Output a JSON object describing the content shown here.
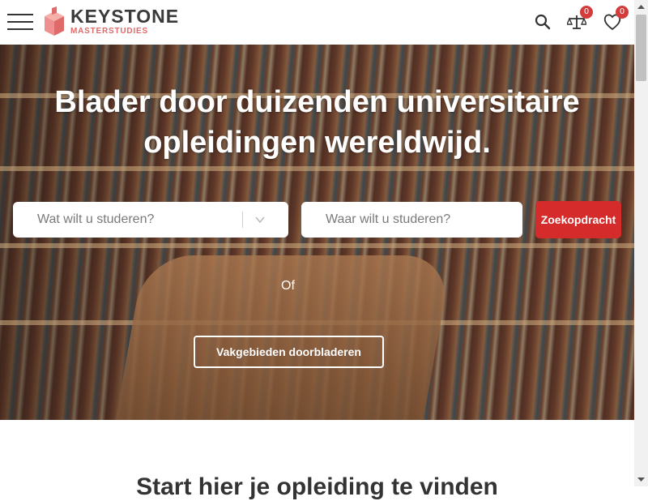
{
  "header": {
    "brand_name": "KEYSTONE",
    "brand_sub": "MASTERSTUDIES",
    "icons": [
      "menu-icon",
      "search-icon",
      "compare-icon",
      "heart-icon"
    ],
    "compare_count": "0",
    "favorites_count": "0",
    "accent_color": "#e06a6a"
  },
  "hero": {
    "headline": "Blader door duizenden universitaire opleidingen wereldwijd.",
    "study_placeholder": "Wat wilt u studeren?",
    "where_placeholder": "Waar wilt u studeren?",
    "search_button": "Zoekopdracht",
    "or_text": "Of",
    "browse_button": "Vakgebieden doorbladeren",
    "button_color": "#d62b2b"
  },
  "section": {
    "title_partial": "Start hier je opleiding te vinden"
  }
}
